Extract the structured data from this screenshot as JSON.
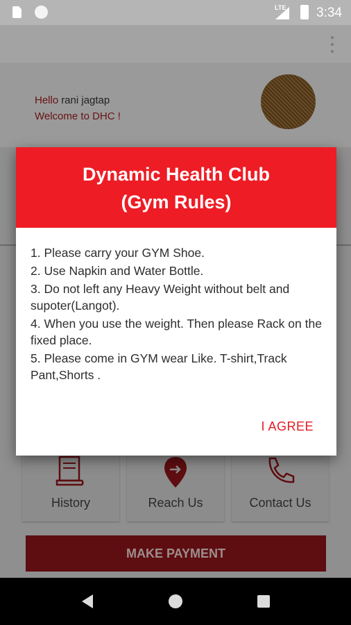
{
  "status_bar": {
    "time": "3:34",
    "network": "LTE"
  },
  "profile": {
    "hello": "Hello",
    "name": "rani jagtap",
    "welcome": "Welcome to DHC !"
  },
  "tiles": [
    {
      "label": "History",
      "icon": "scroll-icon"
    },
    {
      "label": "Reach Us",
      "icon": "map-pin-icon"
    },
    {
      "label": "Contact Us",
      "icon": "phone-icon"
    }
  ],
  "pay_button": "MAKE PAYMENT",
  "dialog": {
    "title_line1": "Dynamic Health Club",
    "title_line2": "(Gym Rules)",
    "rules": [
      "1. Please carry your GYM Shoe.",
      "2. Use Napkin and Water Bottle.",
      "3. Do not left any Heavy Weight without belt and supoter(Langot).",
      "4. When you use the weight. Then please Rack on the fixed place.",
      "5. Please come in GYM wear   Like. T-shirt,Track Pant,Shorts ."
    ],
    "agree_label": "I AGREE"
  },
  "colors": {
    "accent": "#ee1c25",
    "dim_overlay": "#8f8f8f"
  }
}
